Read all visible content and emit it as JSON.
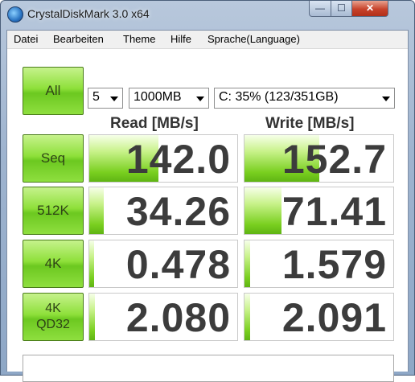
{
  "window": {
    "title": "CrystalDiskMark 3.0 x64"
  },
  "title_buttons": {
    "minimize": "—",
    "maximize": "☐",
    "close": "✕"
  },
  "menu": [
    "Datei",
    "Bearbeiten",
    "Theme",
    "Hilfe",
    "Sprache(Language)"
  ],
  "controls": {
    "all_label": "All",
    "count": "5",
    "size": "1000MB",
    "drive": "C: 35% (123/351GB)"
  },
  "headers": {
    "read": "Read [MB/s]",
    "write": "Write [MB/s]"
  },
  "rows": [
    {
      "label": "Seq",
      "read": "142.0",
      "write": "152.7",
      "read_level": 0.47,
      "write_level": 0.5
    },
    {
      "label": "512K",
      "read": "34.26",
      "write": "71.41",
      "read_level": 0.1,
      "write_level": 0.25
    },
    {
      "label": "4K",
      "read": "0.478",
      "write": "1.579",
      "read_level": 0.03,
      "write_level": 0.04
    },
    {
      "label": "4K QD32",
      "read": "2.080",
      "write": "2.091",
      "read_level": 0.04,
      "write_level": 0.04
    }
  ],
  "comment": "",
  "colors": {
    "accent_green": "#79cf1f",
    "button_border": "#4a7c1a",
    "close_red": "#c7432b"
  }
}
